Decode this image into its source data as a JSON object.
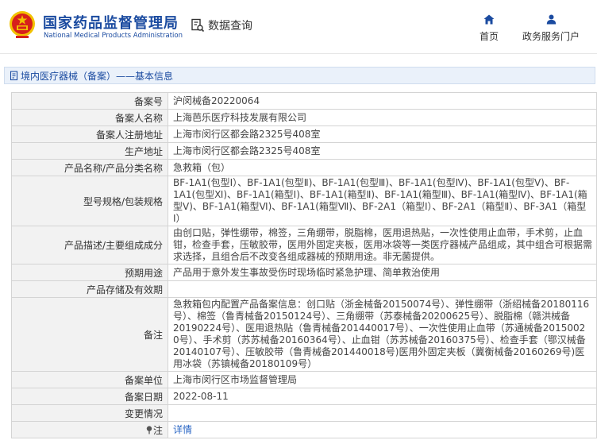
{
  "header": {
    "org_name_cn": "国家药品监督管理局",
    "org_name_en": "National Medical Products Administration",
    "data_query_label": "数据查询",
    "nav": [
      {
        "label": "首页",
        "icon": "home-icon"
      },
      {
        "label": "政务服务门户",
        "icon": "user-icon"
      }
    ]
  },
  "breadcrumb": {
    "text": "境内医疗器械（备案）——基本信息",
    "icon": "document-icon"
  },
  "record": {
    "rows": [
      {
        "label": "备案号",
        "value": "沪闵械备20220064"
      },
      {
        "label": "备案人名称",
        "value": "上海芭乐医疗科技发展有限公司"
      },
      {
        "label": "备案人注册地址",
        "value": "上海市闵行区都会路2325号408室"
      },
      {
        "label": "生产地址",
        "value": "上海市闵行区都会路2325号408室"
      },
      {
        "label": "产品名称/产品分类名称",
        "value": "急救箱（包）"
      },
      {
        "label": "型号规格/包装规格",
        "value": "BF-1A1(包型Ⅰ）、BF-1A1(包型Ⅱ)、BF-1A1(包型Ⅲ)、BF-1A1(包型Ⅳ)、BF-1A1(包型Ⅴ)、BF-1A1(包型Ⅺ)、BF-1A1(箱型Ⅰ)、BF-1A1(箱型Ⅱ)、BF-1A1(箱型Ⅲ)、BF-1A1(箱型Ⅳ)、BF-1A1(箱型Ⅴ)、BF-1A1(箱型Ⅵ)、BF-1A1(箱型Ⅶ)、BF-2A1（箱型Ⅰ）、BF-2A1（箱型Ⅱ）、BF-3A1（箱型Ⅰ）"
      },
      {
        "label": "产品描述/主要组成成分",
        "value": "由创口贴，弹性绷带，棉签，三角绷带，脱脂棉，医用退热贴，一次性使用止血带，手术剪，止血钳，检查手套，压敏胶带，医用外固定夹板，医用冰袋等一类医疗器械产品组成，其中组合可根据需求选择，且组合后不改变各组成器械的预期用途。非无菌提供。"
      },
      {
        "label": "预期用途",
        "value": "产品用于意外发生事故受伤时现场临时紧急护理、简单救治使用"
      },
      {
        "label": "产品存储及有效期",
        "value": ""
      },
      {
        "label": "备注",
        "value": "急救箱包内配置产品备案信息：创口贴（浙金械备20150074号）、弹性绷带（浙绍械备20180116号）、棉签（鲁青械备20150124号）、三角绷带（苏泰械备20200625号）、脱脂棉（赣洪械备20190224号）、医用退热贴（鲁青械备201440017号）、一次性使用止血带（苏通械备2015002 0号）、手术剪（苏苏械备20160364号）、止血钳（苏苏械备20160375号）、检查手套（鄂汉械备20140107号）、压敏胶带（鲁青械备201440018号)医用外固定夹板（冀衡械备20160269号)医用冰袋（苏镇械备20180109号）"
      },
      {
        "label": "备案单位",
        "value": "上海市闵行区市场监督管理局"
      },
      {
        "label": "备案日期",
        "value": "2022-08-11"
      },
      {
        "label": "变更情况",
        "value": ""
      }
    ],
    "note": {
      "label": "注",
      "link_text": "详情",
      "icon": "pin-icon"
    }
  },
  "colors": {
    "brand_blue": "#1b4ba0",
    "emblem_red": "#d7201b",
    "emblem_gold": "#f2c200",
    "label_bg": "#f2f2f2",
    "border": "#d4d4d4",
    "link": "#2a66c4"
  }
}
